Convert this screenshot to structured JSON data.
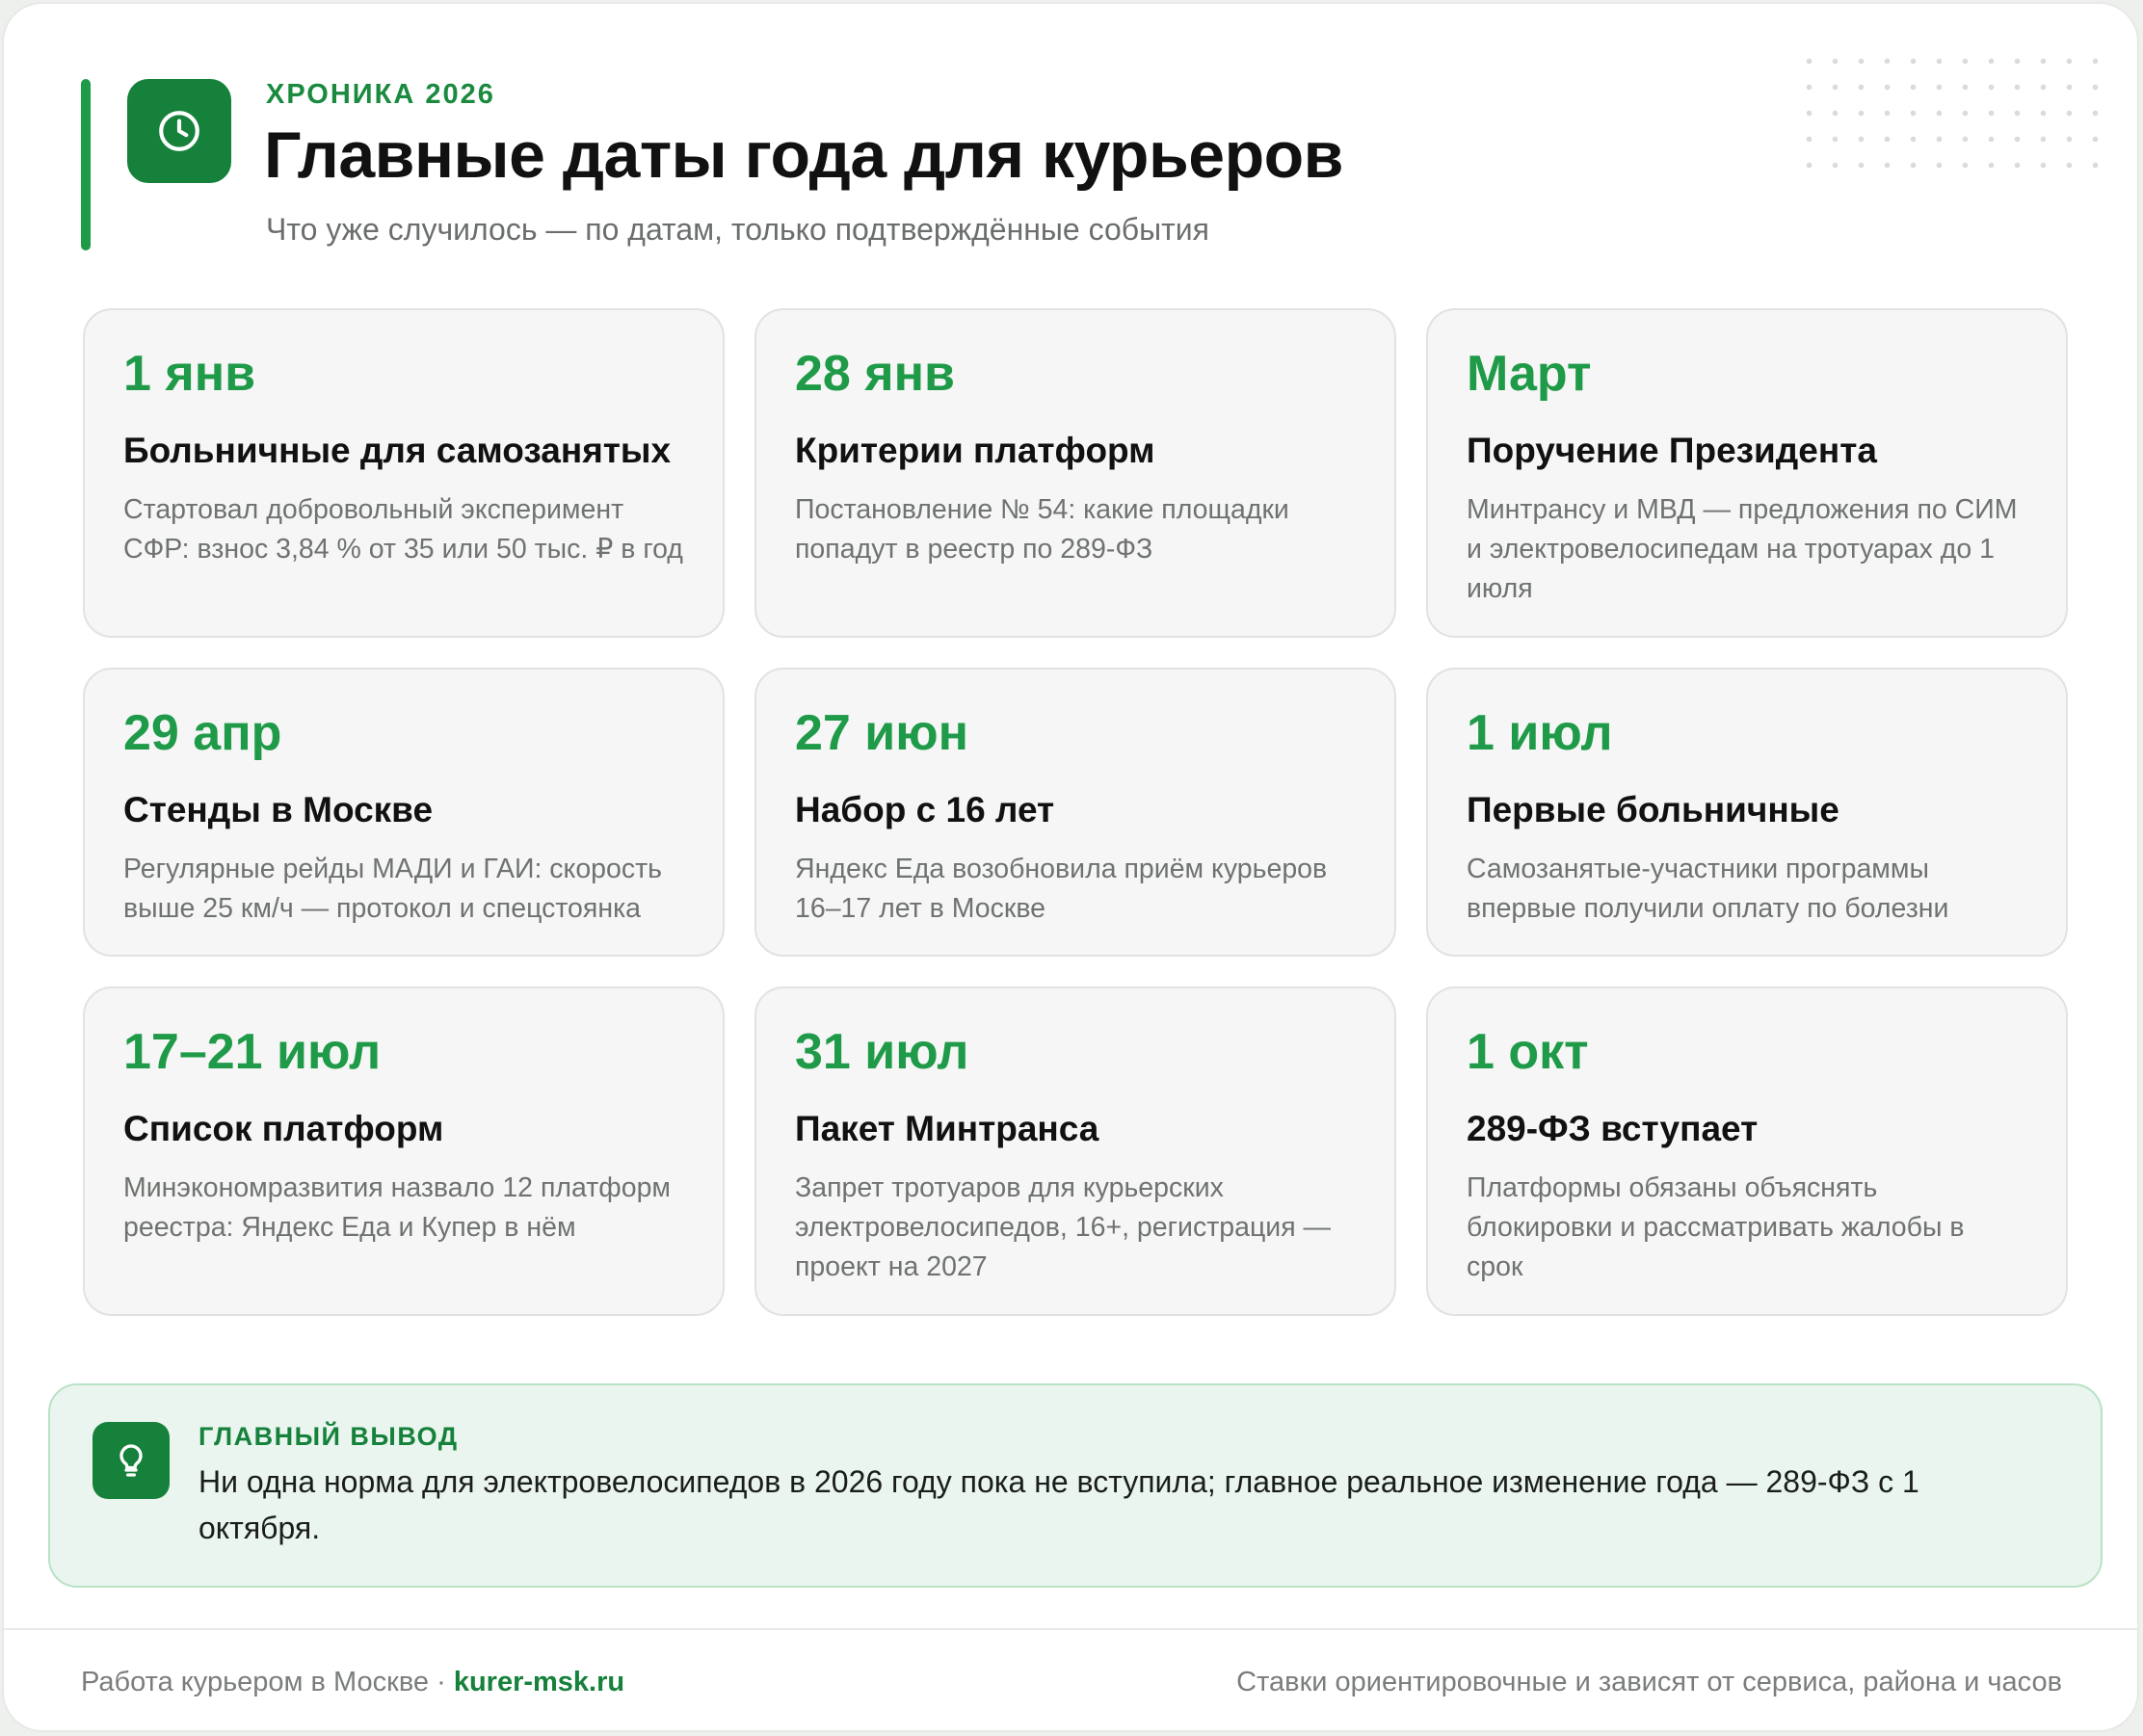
{
  "header": {
    "kicker": "ХРОНИКА 2026",
    "title": "Главные даты года для курьеров",
    "subtitle": "Что уже случилось — по датам, только подтверждённые события",
    "icon": "clock-icon"
  },
  "events": [
    {
      "date": "1 янв",
      "title": "Больничные для самозанятых",
      "desc": "Стартовал добровольный эксперимент СФР: взнос 3,84 % от 35 или 50 тыс. ₽ в год"
    },
    {
      "date": "28 янв",
      "title": "Критерии платформ",
      "desc": "Постановление № 54: какие площадки попадут в реестр по 289-ФЗ"
    },
    {
      "date": "Март",
      "title": "Поручение Президента",
      "desc": "Минтрансу и МВД — предложения по СИМ и электровелосипедам на тротуарах до 1 июля"
    },
    {
      "date": "29 апр",
      "title": "Стенды в Москве",
      "desc": "Регулярные рейды МАДИ и ГАИ: скорость выше 25 км/ч — протокол и спецстоянка"
    },
    {
      "date": "27 июн",
      "title": "Набор с 16 лет",
      "desc": "Яндекс Еда возобновила приём курьеров 16–17 лет в Москве"
    },
    {
      "date": "1 июл",
      "title": "Первые больничные",
      "desc": "Самозанятые-участники программы впервые получили оплату по болезни"
    },
    {
      "date": "17–21 июл",
      "title": "Список платформ",
      "desc": "Минэкономразвития назвало 12 платформ реестра: Яндекс Еда и Купер в нём"
    },
    {
      "date": "31 июл",
      "title": "Пакет Минтранса",
      "desc": "Запрет тротуаров для курьерских электровелосипедов, 16+, регистрация — проект на 2027"
    },
    {
      "date": "1 окт",
      "title": "289-ФЗ вступает",
      "desc": "Платформы обязаны объяснять блокировки и рассматривать жалобы в срок"
    }
  ],
  "summary": {
    "kicker": "ГЛАВНЫЙ ВЫВОД",
    "text": "Ни одна норма для электровелосипедов в 2026 году пока не вступила; главное реальное изменение года — 289-ФЗ с 1 октября.",
    "icon": "lightbulb-icon"
  },
  "footer": {
    "left_text": "Работа курьером в Москве · ",
    "site": "kurer-msk.ru",
    "right_text": "Ставки ориентировочные и зависят от сервиса, района и часов"
  },
  "colors": {
    "accent": "#1f9a48",
    "accent_dark": "#15813a",
    "card_bg": "#f5f6f5",
    "summary_bg": "#e9f5ee"
  }
}
